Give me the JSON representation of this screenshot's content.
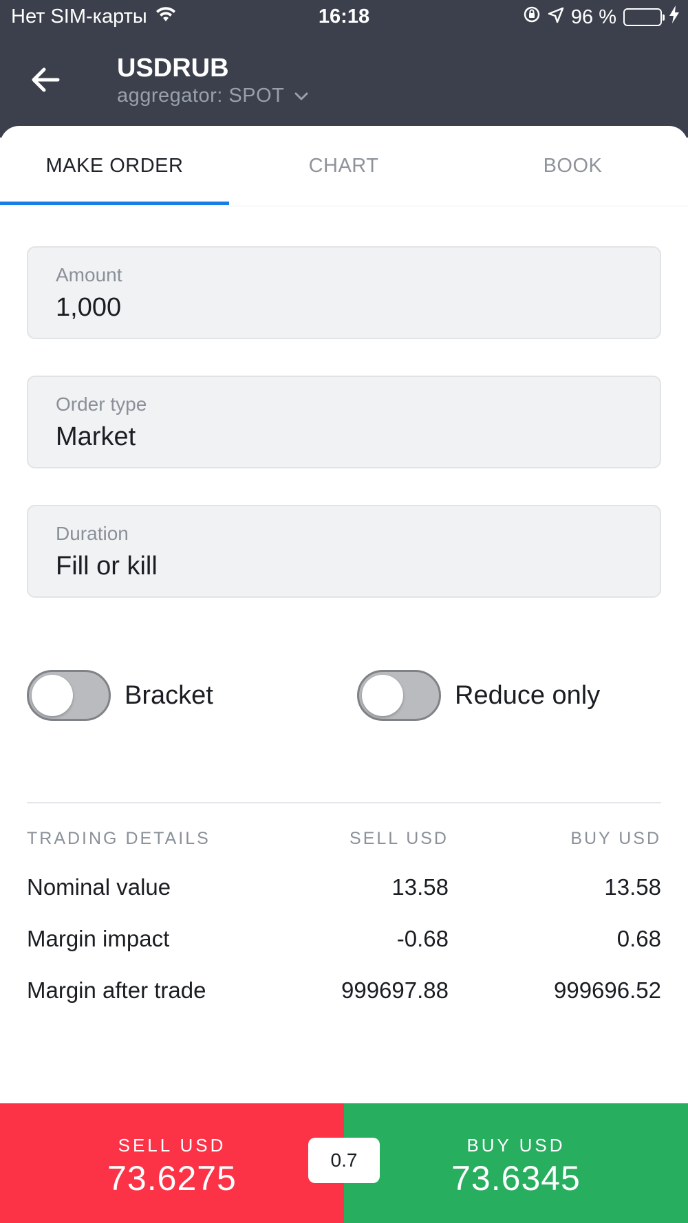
{
  "status_bar": {
    "carrier": "Нет SIM-карты",
    "time": "16:18",
    "battery": "96 %",
    "battery_level": 0.96
  },
  "header": {
    "title": "USDRUB",
    "subtitle": "aggregator: SPOT"
  },
  "tabs": [
    {
      "label": "MAKE ORDER",
      "active": true
    },
    {
      "label": "CHART",
      "active": false
    },
    {
      "label": "BOOK",
      "active": false
    }
  ],
  "form": {
    "amount": {
      "label": "Amount",
      "value": "1,000"
    },
    "order_type": {
      "label": "Order type",
      "value": "Market"
    },
    "duration": {
      "label": "Duration",
      "value": "Fill or kill"
    }
  },
  "toggles": {
    "bracket": {
      "label": "Bracket",
      "on": false
    },
    "reduce_only": {
      "label": "Reduce only",
      "on": false
    }
  },
  "trading_details": {
    "headers": [
      "TRADING DETAILS",
      "SELL USD",
      "BUY USD"
    ],
    "rows": [
      {
        "name": "Nominal value",
        "sell": "13.58",
        "buy": "13.58"
      },
      {
        "name": "Margin impact",
        "sell": "-0.68",
        "buy": "0.68"
      },
      {
        "name": "Margin after trade",
        "sell": "999697.88",
        "buy": "999696.52"
      }
    ]
  },
  "actions": {
    "sell": {
      "label": "SELL USD",
      "price": "73.6275",
      "color": "#fc3346"
    },
    "buy": {
      "label": "BUY USD",
      "price": "73.6345",
      "color": "#27ae5f"
    },
    "spread": "0.7"
  },
  "colors": {
    "header_bg": "#3b404c",
    "accent": "#1a7ee6"
  }
}
